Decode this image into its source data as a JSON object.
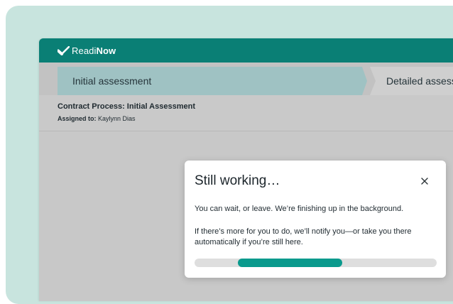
{
  "app": {
    "brand_prefix": "Readi",
    "brand_suffix": "Now",
    "logo_icon": "check-mark-icon"
  },
  "stepper": {
    "steps": [
      {
        "label": "Initial assessment",
        "state": "active"
      },
      {
        "label": "Detailed assessment",
        "state": "pending"
      }
    ]
  },
  "process": {
    "title": "Contract Process: Initial Assessment",
    "assigned_label": "Assigned to:",
    "assigned_value": "Kaylynn Dias"
  },
  "modal": {
    "title": "Still working…",
    "close_icon": "close-icon",
    "line1": "You can wait, or leave. We’re finishing up in the background.",
    "line2": "If there’s more for you to do, we’ll notify you—or take you there automatically if you’re still here.",
    "progress": {
      "kind": "indeterminate",
      "segment_start": 0.18,
      "segment_end": 0.61
    }
  },
  "colors": {
    "accent": "#0a7f75",
    "progress": "#0a9a8d",
    "backdrop": "#c8e4de",
    "active_step": "#9fc2c3"
  }
}
